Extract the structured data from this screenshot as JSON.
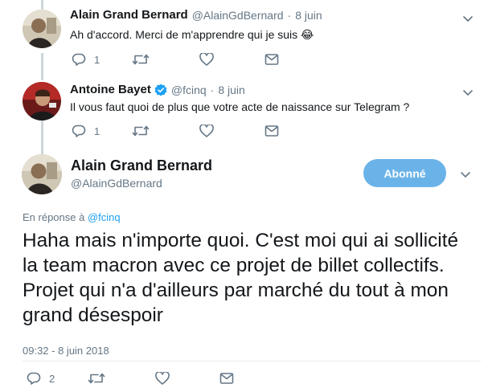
{
  "tweets": [
    {
      "name": "Alain Grand Bernard",
      "handle": "@AlainGdBernard",
      "separator": "·",
      "time": "8 juin",
      "text": "Ah d'accord. Merci de m'apprendre qui je suis 😂",
      "reply_count": "1"
    },
    {
      "name": "Antoine Bayet",
      "handle": "@fcinq",
      "separator": "·",
      "time": "8 juin",
      "text": "Il vous faut quoi de plus que votre acte de naissance sur Telegram ?",
      "reply_count": "1"
    }
  ],
  "main_tweet": {
    "name": "Alain Grand Bernard",
    "handle": "@AlainGdBernard",
    "follow_label": "Abonné",
    "reply_to_prefix": "En réponse à",
    "reply_to_handle": "@fcinq",
    "text": "Haha mais n'importe quoi. C'est moi qui ai sollicité la team macron avec ce projet de billet collectifs. Projet qui n'a d'ailleurs par marché du tout à mon grand désespoir",
    "timestamp": "09:32 - 8 juin 2018",
    "reply_count": "2"
  },
  "colors": {
    "accent": "#1da1f2",
    "follow_button": "#6ab3e8",
    "muted": "#657786",
    "thread_line": "#ccd6dd"
  },
  "icons": [
    "reply-icon",
    "retweet-icon",
    "like-icon",
    "direct-message-icon",
    "chevron-down-icon",
    "verified-badge-icon"
  ]
}
